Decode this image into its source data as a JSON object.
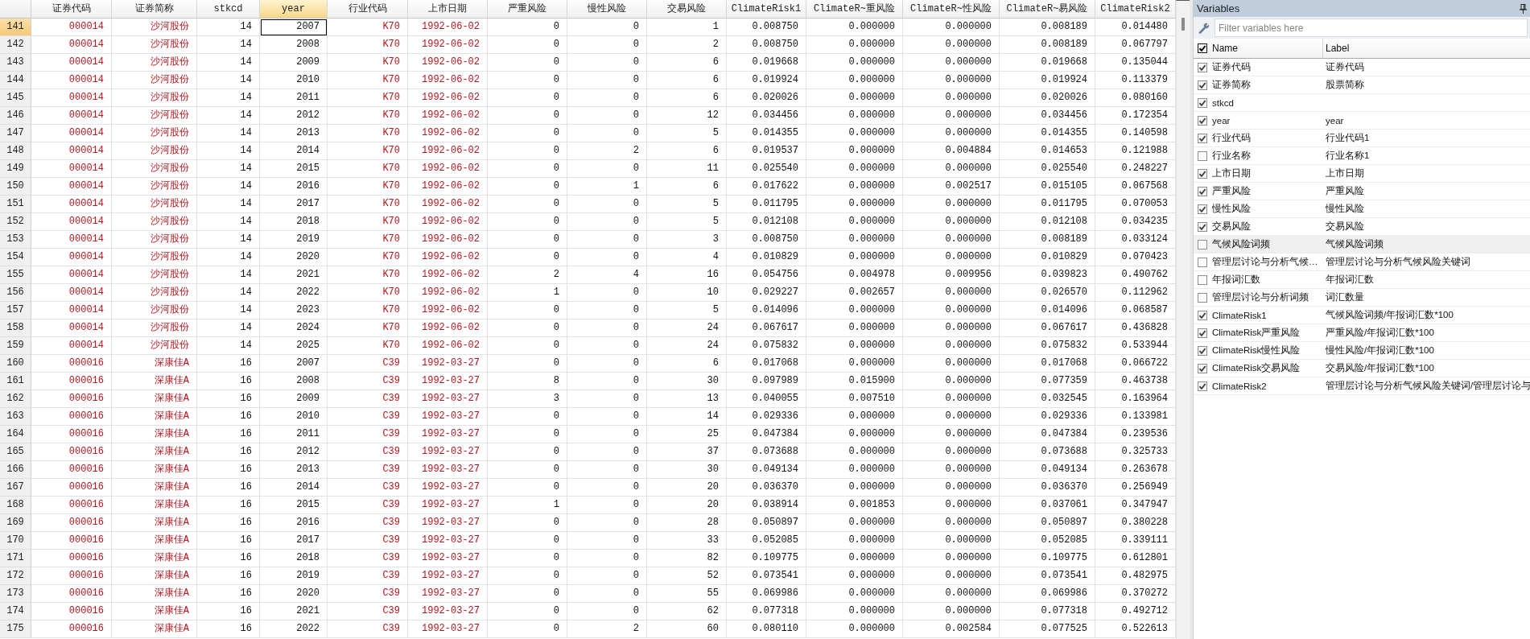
{
  "table": {
    "columns": [
      {
        "label": "证券代码",
        "kind": "text",
        "selected": false
      },
      {
        "label": "证券简称",
        "kind": "text",
        "selected": false
      },
      {
        "label": "stkcd",
        "kind": "number",
        "selected": false
      },
      {
        "label": "year",
        "kind": "number",
        "selected": true
      },
      {
        "label": "行业代码",
        "kind": "text",
        "selected": false
      },
      {
        "label": "上市日期",
        "kind": "text",
        "selected": false
      },
      {
        "label": "严重风险",
        "kind": "number",
        "selected": false
      },
      {
        "label": "慢性风险",
        "kind": "number",
        "selected": false
      },
      {
        "label": "交易风险",
        "kind": "number",
        "selected": false
      },
      {
        "label": "ClimateRisk1",
        "kind": "number",
        "selected": false
      },
      {
        "label": "ClimateR~重风险",
        "kind": "number",
        "selected": false
      },
      {
        "label": "ClimateR~性风险",
        "kind": "number",
        "selected": false
      },
      {
        "label": "ClimateR~易风险",
        "kind": "number",
        "selected": false
      },
      {
        "label": "ClimateRisk2",
        "kind": "number",
        "selected": false
      }
    ],
    "rows": [
      {
        "number": "141",
        "selected": true,
        "cells": [
          "000014",
          "沙河股份",
          "14",
          "2007",
          "K70",
          "1992-06-02",
          "0",
          "0",
          "1",
          "0.008750",
          "0.000000",
          "0.000000",
          "0.008189",
          "0.014480"
        ]
      },
      {
        "number": "142",
        "selected": false,
        "cells": [
          "000014",
          "沙河股份",
          "14",
          "2008",
          "K70",
          "1992-06-02",
          "0",
          "0",
          "2",
          "0.008750",
          "0.000000",
          "0.000000",
          "0.008189",
          "0.067797"
        ]
      },
      {
        "number": "143",
        "selected": false,
        "cells": [
          "000014",
          "沙河股份",
          "14",
          "2009",
          "K70",
          "1992-06-02",
          "0",
          "0",
          "6",
          "0.019668",
          "0.000000",
          "0.000000",
          "0.019668",
          "0.135044"
        ]
      },
      {
        "number": "144",
        "selected": false,
        "cells": [
          "000014",
          "沙河股份",
          "14",
          "2010",
          "K70",
          "1992-06-02",
          "0",
          "0",
          "6",
          "0.019924",
          "0.000000",
          "0.000000",
          "0.019924",
          "0.113379"
        ]
      },
      {
        "number": "145",
        "selected": false,
        "cells": [
          "000014",
          "沙河股份",
          "14",
          "2011",
          "K70",
          "1992-06-02",
          "0",
          "0",
          "6",
          "0.020026",
          "0.000000",
          "0.000000",
          "0.020026",
          "0.080160"
        ]
      },
      {
        "number": "146",
        "selected": false,
        "cells": [
          "000014",
          "沙河股份",
          "14",
          "2012",
          "K70",
          "1992-06-02",
          "0",
          "0",
          "12",
          "0.034456",
          "0.000000",
          "0.000000",
          "0.034456",
          "0.172354"
        ]
      },
      {
        "number": "147",
        "selected": false,
        "cells": [
          "000014",
          "沙河股份",
          "14",
          "2013",
          "K70",
          "1992-06-02",
          "0",
          "0",
          "5",
          "0.014355",
          "0.000000",
          "0.000000",
          "0.014355",
          "0.140598"
        ]
      },
      {
        "number": "148",
        "selected": false,
        "cells": [
          "000014",
          "沙河股份",
          "14",
          "2014",
          "K70",
          "1992-06-02",
          "0",
          "2",
          "6",
          "0.019537",
          "0.000000",
          "0.004884",
          "0.014653",
          "0.121988"
        ]
      },
      {
        "number": "149",
        "selected": false,
        "cells": [
          "000014",
          "沙河股份",
          "14",
          "2015",
          "K70",
          "1992-06-02",
          "0",
          "0",
          "11",
          "0.025540",
          "0.000000",
          "0.000000",
          "0.025540",
          "0.248227"
        ]
      },
      {
        "number": "150",
        "selected": false,
        "cells": [
          "000014",
          "沙河股份",
          "14",
          "2016",
          "K70",
          "1992-06-02",
          "0",
          "1",
          "6",
          "0.017622",
          "0.000000",
          "0.002517",
          "0.015105",
          "0.067568"
        ]
      },
      {
        "number": "151",
        "selected": false,
        "cells": [
          "000014",
          "沙河股份",
          "14",
          "2017",
          "K70",
          "1992-06-02",
          "0",
          "0",
          "5",
          "0.011795",
          "0.000000",
          "0.000000",
          "0.011795",
          "0.070053"
        ]
      },
      {
        "number": "152",
        "selected": false,
        "cells": [
          "000014",
          "沙河股份",
          "14",
          "2018",
          "K70",
          "1992-06-02",
          "0",
          "0",
          "5",
          "0.012108",
          "0.000000",
          "0.000000",
          "0.012108",
          "0.034235"
        ]
      },
      {
        "number": "153",
        "selected": false,
        "cells": [
          "000014",
          "沙河股份",
          "14",
          "2019",
          "K70",
          "1992-06-02",
          "0",
          "0",
          "3",
          "0.008750",
          "0.000000",
          "0.000000",
          "0.008189",
          "0.033124"
        ]
      },
      {
        "number": "154",
        "selected": false,
        "cells": [
          "000014",
          "沙河股份",
          "14",
          "2020",
          "K70",
          "1992-06-02",
          "0",
          "0",
          "4",
          "0.010829",
          "0.000000",
          "0.000000",
          "0.010829",
          "0.070423"
        ]
      },
      {
        "number": "155",
        "selected": false,
        "cells": [
          "000014",
          "沙河股份",
          "14",
          "2021",
          "K70",
          "1992-06-02",
          "2",
          "4",
          "16",
          "0.054756",
          "0.004978",
          "0.009956",
          "0.039823",
          "0.490762"
        ]
      },
      {
        "number": "156",
        "selected": false,
        "cells": [
          "000014",
          "沙河股份",
          "14",
          "2022",
          "K70",
          "1992-06-02",
          "1",
          "0",
          "10",
          "0.029227",
          "0.002657",
          "0.000000",
          "0.026570",
          "0.112962"
        ]
      },
      {
        "number": "157",
        "selected": false,
        "cells": [
          "000014",
          "沙河股份",
          "14",
          "2023",
          "K70",
          "1992-06-02",
          "0",
          "0",
          "5",
          "0.014096",
          "0.000000",
          "0.000000",
          "0.014096",
          "0.068587"
        ]
      },
      {
        "number": "158",
        "selected": false,
        "cells": [
          "000014",
          "沙河股份",
          "14",
          "2024",
          "K70",
          "1992-06-02",
          "0",
          "0",
          "24",
          "0.067617",
          "0.000000",
          "0.000000",
          "0.067617",
          "0.436828"
        ]
      },
      {
        "number": "159",
        "selected": false,
        "cells": [
          "000014",
          "沙河股份",
          "14",
          "2025",
          "K70",
          "1992-06-02",
          "0",
          "0",
          "24",
          "0.075832",
          "0.000000",
          "0.000000",
          "0.075832",
          "0.533944"
        ]
      },
      {
        "number": "160",
        "selected": false,
        "cells": [
          "000016",
          "深康佳A",
          "16",
          "2007",
          "C39",
          "1992-03-27",
          "0",
          "0",
          "6",
          "0.017068",
          "0.000000",
          "0.000000",
          "0.017068",
          "0.066722"
        ]
      },
      {
        "number": "161",
        "selected": false,
        "cells": [
          "000016",
          "深康佳A",
          "16",
          "2008",
          "C39",
          "1992-03-27",
          "8",
          "0",
          "30",
          "0.097989",
          "0.015900",
          "0.000000",
          "0.077359",
          "0.463738"
        ]
      },
      {
        "number": "162",
        "selected": false,
        "cells": [
          "000016",
          "深康佳A",
          "16",
          "2009",
          "C39",
          "1992-03-27",
          "3",
          "0",
          "13",
          "0.040055",
          "0.007510",
          "0.000000",
          "0.032545",
          "0.163964"
        ]
      },
      {
        "number": "163",
        "selected": false,
        "cells": [
          "000016",
          "深康佳A",
          "16",
          "2010",
          "C39",
          "1992-03-27",
          "0",
          "0",
          "14",
          "0.029336",
          "0.000000",
          "0.000000",
          "0.029336",
          "0.133981"
        ]
      },
      {
        "number": "164",
        "selected": false,
        "cells": [
          "000016",
          "深康佳A",
          "16",
          "2011",
          "C39",
          "1992-03-27",
          "0",
          "0",
          "25",
          "0.047384",
          "0.000000",
          "0.000000",
          "0.047384",
          "0.239536"
        ]
      },
      {
        "number": "165",
        "selected": false,
        "cells": [
          "000016",
          "深康佳A",
          "16",
          "2012",
          "C39",
          "1992-03-27",
          "0",
          "0",
          "37",
          "0.073688",
          "0.000000",
          "0.000000",
          "0.073688",
          "0.325733"
        ]
      },
      {
        "number": "166",
        "selected": false,
        "cells": [
          "000016",
          "深康佳A",
          "16",
          "2013",
          "C39",
          "1992-03-27",
          "0",
          "0",
          "30",
          "0.049134",
          "0.000000",
          "0.000000",
          "0.049134",
          "0.263678"
        ]
      },
      {
        "number": "167",
        "selected": false,
        "cells": [
          "000016",
          "深康佳A",
          "16",
          "2014",
          "C39",
          "1992-03-27",
          "0",
          "0",
          "20",
          "0.036370",
          "0.000000",
          "0.000000",
          "0.036370",
          "0.256949"
        ]
      },
      {
        "number": "168",
        "selected": false,
        "cells": [
          "000016",
          "深康佳A",
          "16",
          "2015",
          "C39",
          "1992-03-27",
          "1",
          "0",
          "20",
          "0.038914",
          "0.001853",
          "0.000000",
          "0.037061",
          "0.347947"
        ]
      },
      {
        "number": "169",
        "selected": false,
        "cells": [
          "000016",
          "深康佳A",
          "16",
          "2016",
          "C39",
          "1992-03-27",
          "0",
          "0",
          "28",
          "0.050897",
          "0.000000",
          "0.000000",
          "0.050897",
          "0.380228"
        ]
      },
      {
        "number": "170",
        "selected": false,
        "cells": [
          "000016",
          "深康佳A",
          "16",
          "2017",
          "C39",
          "1992-03-27",
          "0",
          "0",
          "33",
          "0.052085",
          "0.000000",
          "0.000000",
          "0.052085",
          "0.339111"
        ]
      },
      {
        "number": "171",
        "selected": false,
        "cells": [
          "000016",
          "深康佳A",
          "16",
          "2018",
          "C39",
          "1992-03-27",
          "0",
          "0",
          "82",
          "0.109775",
          "0.000000",
          "0.000000",
          "0.109775",
          "0.612801"
        ]
      },
      {
        "number": "172",
        "selected": false,
        "cells": [
          "000016",
          "深康佳A",
          "16",
          "2019",
          "C39",
          "1992-03-27",
          "0",
          "0",
          "52",
          "0.073541",
          "0.000000",
          "0.000000",
          "0.073541",
          "0.482975"
        ]
      },
      {
        "number": "173",
        "selected": false,
        "cells": [
          "000016",
          "深康佳A",
          "16",
          "2020",
          "C39",
          "1992-03-27",
          "0",
          "0",
          "55",
          "0.069986",
          "0.000000",
          "0.000000",
          "0.069986",
          "0.370272"
        ]
      },
      {
        "number": "174",
        "selected": false,
        "cells": [
          "000016",
          "深康佳A",
          "16",
          "2021",
          "C39",
          "1992-03-27",
          "0",
          "0",
          "62",
          "0.077318",
          "0.000000",
          "0.000000",
          "0.077318",
          "0.492712"
        ]
      },
      {
        "number": "175",
        "selected": false,
        "cells": [
          "000016",
          "深康佳A",
          "16",
          "2022",
          "C39",
          "1992-03-27",
          "0",
          "2",
          "60",
          "0.080110",
          "0.000000",
          "0.002584",
          "0.077525",
          "0.522613"
        ]
      }
    ]
  },
  "variables_panel": {
    "title": "Variables",
    "filter": {
      "placeholder": "Filter variables here"
    },
    "select_all": {
      "checked": true
    },
    "columns": [
      {
        "label": "Name"
      },
      {
        "label": "Label"
      }
    ],
    "items": [
      {
        "name": "证券代码",
        "label": "证券代码",
        "checked": true,
        "selected": false
      },
      {
        "name": "证券简称",
        "label": "股票简称",
        "checked": true,
        "selected": false
      },
      {
        "name": "stkcd",
        "checked": true,
        "selected": false
      },
      {
        "name": "year",
        "label": "year",
        "checked": true,
        "selected": false
      },
      {
        "name": "行业代码",
        "label": "行业代码1",
        "checked": true,
        "selected": false
      },
      {
        "name": "行业名称",
        "label": "行业名称1",
        "checked": false,
        "selected": false
      },
      {
        "name": "上市日期",
        "label": "上市日期",
        "checked": true,
        "selected": false
      },
      {
        "name": "严重风险",
        "label": "严重风险",
        "checked": true,
        "selected": false
      },
      {
        "name": "慢性风险",
        "label": "慢性风险",
        "checked": true,
        "selected": false
      },
      {
        "name": "交易风险",
        "label": "交易风险",
        "checked": true,
        "selected": false
      },
      {
        "name": "气候风险词频",
        "label": "气候风险词频",
        "checked": false,
        "selected": true
      },
      {
        "name": "管理层讨论与分析气候…",
        "label": "管理层讨论与分析气候风险关键词",
        "checked": false,
        "selected": false
      },
      {
        "name": "年报词汇数",
        "label": "年报词汇数",
        "checked": false,
        "selected": false
      },
      {
        "name": "管理层讨论与分析词频",
        "label": "词汇数量",
        "checked": false,
        "selected": false
      },
      {
        "name": "ClimateRisk1",
        "label": "气候风险词频/年报词汇数*100",
        "checked": true,
        "selected": false
      },
      {
        "name": "ClimateRisk严重风险",
        "label": "严重风险/年报词汇数*100",
        "checked": true,
        "selected": false
      },
      {
        "name": "ClimateRisk慢性风险",
        "label": "慢性风险/年报词汇数*100",
        "checked": true,
        "selected": false
      },
      {
        "name": "ClimateRisk交易风险",
        "label": "交易风险/年报词汇数*100",
        "checked": true,
        "selected": false
      },
      {
        "name": "ClimateRisk2",
        "label": "管理层讨论与分析气候风险关键词/管理层讨论与",
        "checked": true,
        "selected": false
      }
    ]
  }
}
